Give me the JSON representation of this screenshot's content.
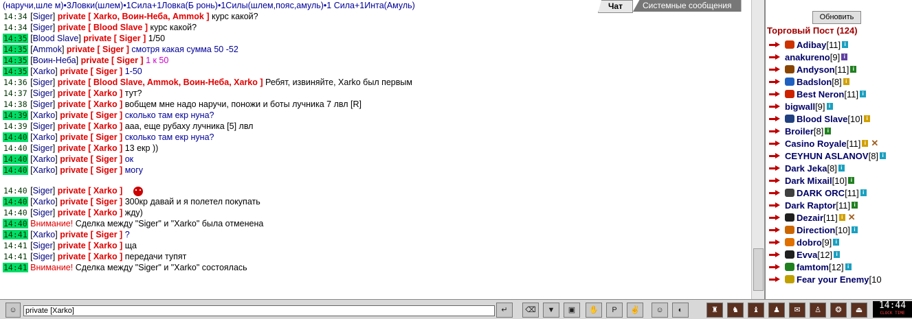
{
  "top_text": "(наручи,шле м)•3Ловки(шлем)•1Сила+1Ловка(Б ронь)•1Силы(шлем,пояс,амуль)•1 Сила+1Инта(Амуль)",
  "tabs": [
    "Чат",
    "Системные сообщения"
  ],
  "messages": [
    {
      "time": "14:34",
      "hl": false,
      "sender": "Siger",
      "to": "Xarko, Воин-Неба, Ammok",
      "text": "курс какой?",
      "style": "msg"
    },
    {
      "time": "14:34",
      "hl": false,
      "sender": "Siger",
      "to": "Blood Slave",
      "text": "курс какой?",
      "style": "msg"
    },
    {
      "time": "14:35",
      "hl": true,
      "sender": "Blood Slave",
      "to": "Siger",
      "text": "1/50",
      "style": "msg"
    },
    {
      "time": "14:35",
      "hl": true,
      "sender": "Ammok",
      "to": "Siger",
      "text": "смотря какая сумма 50 -52",
      "style": "blue"
    },
    {
      "time": "14:35",
      "hl": true,
      "sender": "Воин-Неба",
      "to": "Siger",
      "text": "1 к 50",
      "style": "pink"
    },
    {
      "time": "14:35",
      "hl": true,
      "sender": "Xarko",
      "to": "Siger",
      "text": "1-50",
      "style": "blue"
    },
    {
      "time": "14:36",
      "hl": false,
      "sender": "Siger",
      "to": "Blood Slave, Ammok, Воин-Неба, Xarko",
      "text": "Ребят, извиняйте, Xarko был первым",
      "style": "msg"
    },
    {
      "time": "14:37",
      "hl": false,
      "sender": "Siger",
      "to": "Xarko",
      "text": "тут?",
      "style": "msg"
    },
    {
      "time": "14:38",
      "hl": false,
      "sender": "Siger",
      "to": "Xarko",
      "text": "вобщем мне надо наручи, поножи и боты лучника 7 лвл [R]",
      "style": "msg"
    },
    {
      "time": "14:39",
      "hl": true,
      "sender": "Xarko",
      "to": "Siger",
      "text": "сколько там екр нуна?",
      "style": "blue"
    },
    {
      "time": "14:39",
      "hl": false,
      "sender": "Siger",
      "to": "Xarko",
      "text": "ааа, еще рубаху лучника [5] лвл",
      "style": "msg"
    },
    {
      "time": "14:40",
      "hl": true,
      "sender": "Xarko",
      "to": "Siger",
      "text": "сколько там екр нуна?",
      "style": "blue"
    },
    {
      "time": "14:40",
      "hl": false,
      "sender": "Siger",
      "to": "Xarko",
      "text": "13 екр ))",
      "style": "msg"
    },
    {
      "time": "14:40",
      "hl": true,
      "sender": "Xarko",
      "to": "Siger",
      "text": "ок",
      "style": "blue"
    },
    {
      "time": "14:40",
      "hl": true,
      "sender": "Xarko",
      "to": "Siger",
      "text": "могу",
      "style": "blue"
    }
  ],
  "messages2": [
    {
      "time": "14:40",
      "hl": false,
      "sender": "Siger",
      "to": "Xarko",
      "text": "",
      "style": "msg",
      "smile": true
    },
    {
      "time": "14:40",
      "hl": true,
      "sender": "Xarko",
      "to": "Siger",
      "text": "300кр давай и я полетел покупать",
      "style": "msg"
    },
    {
      "time": "14:40",
      "hl": false,
      "sender": "Siger",
      "to": "Xarko",
      "text": "жду)",
      "style": "msg"
    },
    {
      "time": "14:40",
      "hl": true,
      "warn": "Внимание!",
      "text": "Сделка между \"Siger\" и \"Xarko\" была отменена"
    },
    {
      "time": "14:41",
      "hl": true,
      "sender": "Xarko",
      "to": "Siger",
      "text": "?",
      "style": "blue"
    },
    {
      "time": "14:41",
      "hl": false,
      "sender": "Siger",
      "to": "Xarko",
      "text": "ща",
      "style": "msg"
    },
    {
      "time": "14:41",
      "hl": false,
      "sender": "Siger",
      "to": "Xarko",
      "text": "передачи тупят",
      "style": "msg"
    },
    {
      "time": "14:41",
      "hl": true,
      "warn": "Внимание!",
      "text": "Сделка между \"Siger\" и \"Xarko\" состоялась"
    }
  ],
  "private_label": "private",
  "sidebar": {
    "refresh_label": "Обновить",
    "title": "Торговый Пост (124)",
    "users": [
      {
        "name": "Adibay",
        "level": "[11]",
        "info": "cyan",
        "icon": "#cc3300",
        "indent": 1
      },
      {
        "name": "anakureno",
        "level": "[9]",
        "info": "purple",
        "icon": "",
        "indent": 0
      },
      {
        "name": "Andyson",
        "level": "[11]",
        "info": "green",
        "icon": "#884400",
        "indent": 1
      },
      {
        "name": "Badslon",
        "level": "[8]",
        "info": "yellow",
        "icon": "#2060c0",
        "indent": 1
      },
      {
        "name": "Best Neron",
        "level": "[11]",
        "info": "cyan",
        "icon": "#cc2200",
        "indent": 1
      },
      {
        "name": "bigwall",
        "level": "[9]",
        "info": "cyan",
        "icon": "",
        "indent": 0
      },
      {
        "name": "Blood Slave",
        "level": "[10]",
        "info": "yellow",
        "icon": "#204080",
        "indent": 1
      },
      {
        "name": "Broiler",
        "level": "[8]",
        "info": "green",
        "icon": "",
        "indent": 0
      },
      {
        "name": "Casino Royale",
        "level": "[11]",
        "info": "yellow",
        "icon": "",
        "indent": 0,
        "extra": "✕"
      },
      {
        "name": "CEYHUN ASLANOV",
        "level": "[8]",
        "info": "cyan",
        "icon": "",
        "indent": 0
      },
      {
        "name": "Dark Jeka",
        "level": "[8]",
        "info": "cyan",
        "icon": "",
        "indent": 0
      },
      {
        "name": "Dark Mixail",
        "level": "[10]",
        "info": "green",
        "icon": "",
        "indent": 0
      },
      {
        "name": "DARK ORC",
        "level": "[11]",
        "info": "cyan",
        "icon": "#404040",
        "indent": 1
      },
      {
        "name": "Dark Raptor",
        "level": "[11]",
        "info": "green",
        "icon": "",
        "indent": 0
      },
      {
        "name": "Dezair",
        "level": "[11]",
        "info": "yellow",
        "icon": "#202020",
        "indent": 1,
        "extra": "✕"
      },
      {
        "name": "Direction",
        "level": "[10]",
        "info": "cyan",
        "icon": "#cc6600",
        "indent": 1
      },
      {
        "name": "dobro",
        "level": "[9]",
        "info": "cyan",
        "icon": "#e07000",
        "indent": 1
      },
      {
        "name": "Evva",
        "level": "[12]",
        "info": "cyan",
        "icon": "#202020",
        "indent": 1
      },
      {
        "name": "famtom",
        "level": "[12]",
        "info": "cyan",
        "icon": "#208020",
        "indent": 1
      },
      {
        "name": "Fear your Enemy",
        "level": "[10",
        "info": "",
        "icon": "#c0a000",
        "indent": 1
      }
    ]
  },
  "input": {
    "value": "private [Xarko]"
  },
  "clock": {
    "time": "14:44",
    "label": "CLOCK TIME"
  }
}
